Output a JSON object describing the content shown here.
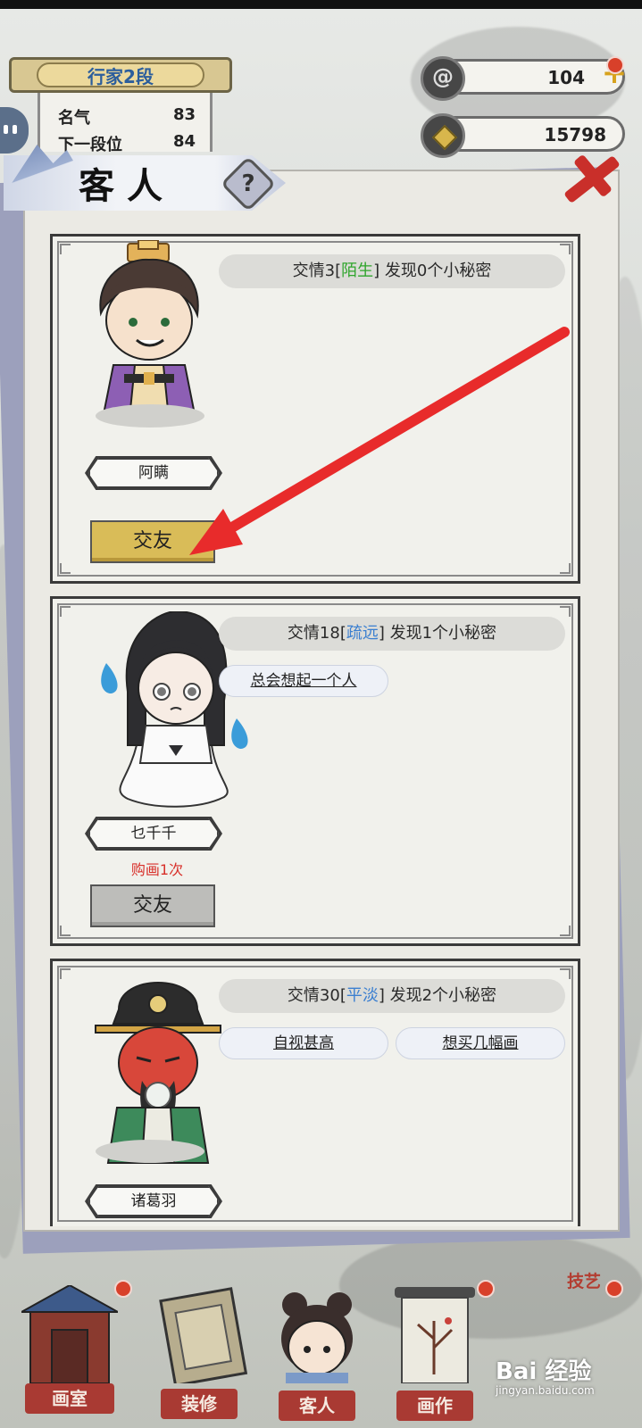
{
  "player": {
    "rank_title": "行家2段",
    "fame_label": "名气",
    "fame_value": "83",
    "next_rank_label": "下一段位",
    "next_rank_value": "84"
  },
  "currency": {
    "ink": "104",
    "coins": "15798"
  },
  "modal": {
    "title": "客人",
    "help_label": "?"
  },
  "guests": [
    {
      "name": "阿瞒",
      "relation_prefix": "交情3[",
      "relation_level": "陌生",
      "relation_suffix": "] 发现0个小秘密",
      "tags": [],
      "note": "",
      "friend_button": "交友",
      "friend_enabled": true
    },
    {
      "name": "乜千千",
      "relation_prefix": "交情18[",
      "relation_level": "疏远",
      "relation_suffix": "] 发现1个小秘密",
      "tags": [
        "总会想起一个人"
      ],
      "note": "购画1次",
      "friend_button": "交友",
      "friend_enabled": false
    },
    {
      "name": "诸葛羽",
      "relation_prefix": "交情30[",
      "relation_level": "平淡",
      "relation_suffix": "] 发现2个小秘密",
      "tags": [
        "自视甚高",
        "想买几幅画"
      ],
      "note": "",
      "friend_button": "",
      "friend_enabled": false
    }
  ],
  "nav": {
    "studio": "画室",
    "decorate": "装修",
    "guests": "客人",
    "paint": "画作",
    "skills": "技艺"
  },
  "watermark": {
    "brand": "Bai 经验",
    "url": "jingyan.baidu.com"
  },
  "colors": {
    "relation_stranger": "#2fa52c",
    "relation_level": "#3b7fd0",
    "note_red": "#d8302a",
    "friend_active": "#d9bc58",
    "friend_inactive": "#bdbdba",
    "arrow_red": "#e82b2b"
  },
  "icons": {
    "close": "close-x-icon",
    "help": "question-icon",
    "ink": "ink-swirl-icon",
    "coin": "coin-icon",
    "plus": "plus-icon"
  }
}
